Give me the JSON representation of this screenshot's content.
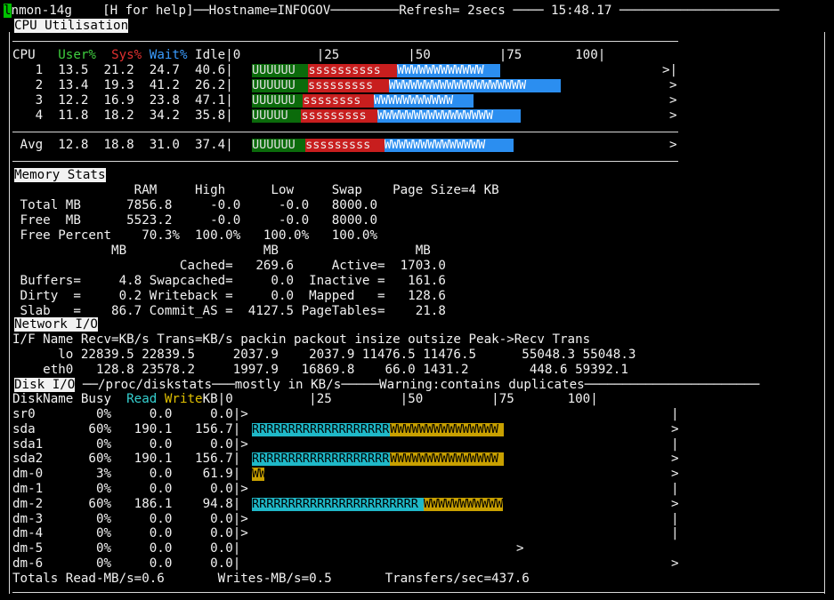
{
  "header": {
    "cursor": "l",
    "title": "nmon-14g",
    "help": "[H for help]",
    "hostname": "Hostname=INFOGOV",
    "refresh": "Refresh= 2secs",
    "clock": "15:48.17"
  },
  "cpu": {
    "section_label": "CPU Utilisation",
    "col_cpu": "CPU",
    "col_user": "User%",
    "col_sys": "Sys%",
    "col_wait": "Wait%",
    "col_idle": "Idle",
    "scale": "0          |25         |50         |75       100|",
    "rows": [
      {
        "cpu": "1",
        "user": "13.5",
        "sys": "21.2",
        "wait": "24.7",
        "idle": "40.6",
        "u": "UUUUUU",
        "s": "ssssssssss",
        "w": "WWWWWWWWWWWW",
        "u_pct": 13.5,
        "s_pct": 21.2,
        "w_pct": 24.7,
        "end": ">|"
      },
      {
        "cpu": "2",
        "user": "13.4",
        "sys": "19.3",
        "wait": "41.2",
        "idle": "26.2",
        "u": "UUUUUU",
        "s": "sssssssss",
        "w": "WWWWWWWWWWWWWWWWWWW",
        "u_pct": 13.4,
        "s_pct": 19.3,
        "w_pct": 41.2,
        "end": ">"
      },
      {
        "cpu": "3",
        "user": "12.2",
        "sys": "16.9",
        "wait": "23.8",
        "idle": "47.1",
        "u": "UUUUUU",
        "s": "ssssssss",
        "w": "WWWWWWWWWWW",
        "u_pct": 12.2,
        "s_pct": 16.9,
        "w_pct": 23.8,
        "end": ">"
      },
      {
        "cpu": "4",
        "user": "11.8",
        "sys": "18.2",
        "wait": "34.2",
        "idle": "35.8",
        "u": "UUUUU",
        "s": "sssssssss",
        "w": "WWWWWWWWWWWWWWWW",
        "u_pct": 11.8,
        "s_pct": 18.2,
        "w_pct": 34.2,
        "end": ">"
      }
    ],
    "avg": {
      "cpu": "Avg",
      "user": "12.8",
      "sys": "18.8",
      "wait": "31.0",
      "idle": "37.4",
      "u": "UUUUUU",
      "s": "sssssssss",
      "w": "WWWWWWWWWWWWWW",
      "u_pct": 12.8,
      "s_pct": 18.8,
      "w_pct": 31.0,
      "end": ">"
    }
  },
  "memory": {
    "section_label": "Memory Stats",
    "lines": [
      "                RAM     High      Low     Swap    Page Size=4 KB",
      " Total MB      7856.8     -0.0     -0.0   8000.0",
      " Free  MB      5523.2     -0.0     -0.0   8000.0",
      " Free Percent    70.3%  100.0%   100.0%   100.0%",
      "             MB                  MB                  MB",
      "                      Cached=   269.6     Active=  1703.0",
      " Buffers=     4.8 Swapcached=     0.0  Inactive =   161.6",
      " Dirty  =     0.2 Writeback =     0.0  Mapped   =   128.6",
      " Slab   =    86.7 Commit_AS =  4127.5 PageTables=    21.8"
    ]
  },
  "network": {
    "section_label": "Network I/O",
    "lines": [
      "I/F Name Recv=KB/s Trans=KB/s packin packout insize outsize Peak->Recv Trans",
      "      lo 22839.5 22839.5     2037.9    2037.9 11476.5 11476.5      55048.3 55048.3",
      "    eth0   128.8 23578.2     1997.9   16869.8    66.0 1431.2        448.6 59392.1"
    ]
  },
  "disk": {
    "section_label": "Disk I/O",
    "path": "/proc/diskstats",
    "note": "mostly in KB/s",
    "warning": "Warning:contains duplicates",
    "col_name": "DiskName Busy",
    "col_read": "Read",
    "col_write": "Write",
    "col_unit": "KB|",
    "scale": "0          |25         |50         |75       100|",
    "rows": [
      {
        "name": "sr0",
        "busy": "0%",
        "read": "0.0",
        "write": "0.0",
        "r": "",
        "w": "",
        "r_pct": 0,
        "w_pct": 0,
        "end": ">",
        "tail": "|"
      },
      {
        "name": "sda",
        "busy": "60%",
        "read": "190.1",
        "write": "156.7",
        "r": "RRRRRRRRRRRRRRRRRRR",
        "w": "WWWWWWWWWWWWWWW",
        "r_pct": 33.0,
        "w_pct": 27.2,
        "end": "",
        "tail": ">"
      },
      {
        "name": "sda1",
        "busy": "0%",
        "read": "0.0",
        "write": "0.0",
        "r": "",
        "w": "",
        "r_pct": 0,
        "w_pct": 0,
        "end": ">",
        "tail": "|"
      },
      {
        "name": "sda2",
        "busy": "60%",
        "read": "190.1",
        "write": "156.7",
        "r": "RRRRRRRRRRRRRRRRRRR",
        "w": "WWWWWWWWWWWWWWW",
        "r_pct": 33.0,
        "w_pct": 27.2,
        "end": "",
        "tail": ">"
      },
      {
        "name": "dm-0",
        "busy": "3%",
        "read": "0.0",
        "write": "61.9",
        "r": "",
        "w": "WW",
        "r_pct": 0,
        "w_pct": 3.0,
        "end": "",
        "tail": ">"
      },
      {
        "name": "dm-1",
        "busy": "0%",
        "read": "0.0",
        "write": "0.0",
        "r": "",
        "w": "",
        "r_pct": 0,
        "w_pct": 0,
        "end": ">",
        "tail": "|"
      },
      {
        "name": "dm-2",
        "busy": "60%",
        "read": "186.1",
        "write": "94.8",
        "r": "RRRRRRRRRRRRRRRRRRRRRRR",
        "w": "WWWWWWWWWWW",
        "r_pct": 41.0,
        "w_pct": 19.0,
        "end": "",
        "tail": ">"
      },
      {
        "name": "dm-3",
        "busy": "0%",
        "read": "0.0",
        "write": "0.0",
        "r": "",
        "w": "",
        "r_pct": 0,
        "w_pct": 0,
        "end": ">",
        "tail": "|"
      },
      {
        "name": "dm-4",
        "busy": "0%",
        "read": "0.0",
        "write": "0.0",
        "r": "",
        "w": "",
        "r_pct": 0,
        "w_pct": 0,
        "end": ">",
        "tail": "|"
      },
      {
        "name": "dm-5",
        "busy": "0%",
        "read": "0.0",
        "write": "0.0",
        "r": "",
        "w": "",
        "r_pct": 0,
        "w_pct": 0,
        "end": "",
        "tail": ">"
      },
      {
        "name": "dm-6",
        "busy": "0%",
        "read": "0.0",
        "write": "0.0",
        "r": "",
        "w": "",
        "r_pct": 0,
        "w_pct": 0,
        "end": "",
        "tail": ">"
      }
    ],
    "totals_read": "Totals Read-MB/s=0.6",
    "totals_write": "Writes-MB/s=0.5",
    "totals_transfers": "Transfers/sec=437.6"
  }
}
